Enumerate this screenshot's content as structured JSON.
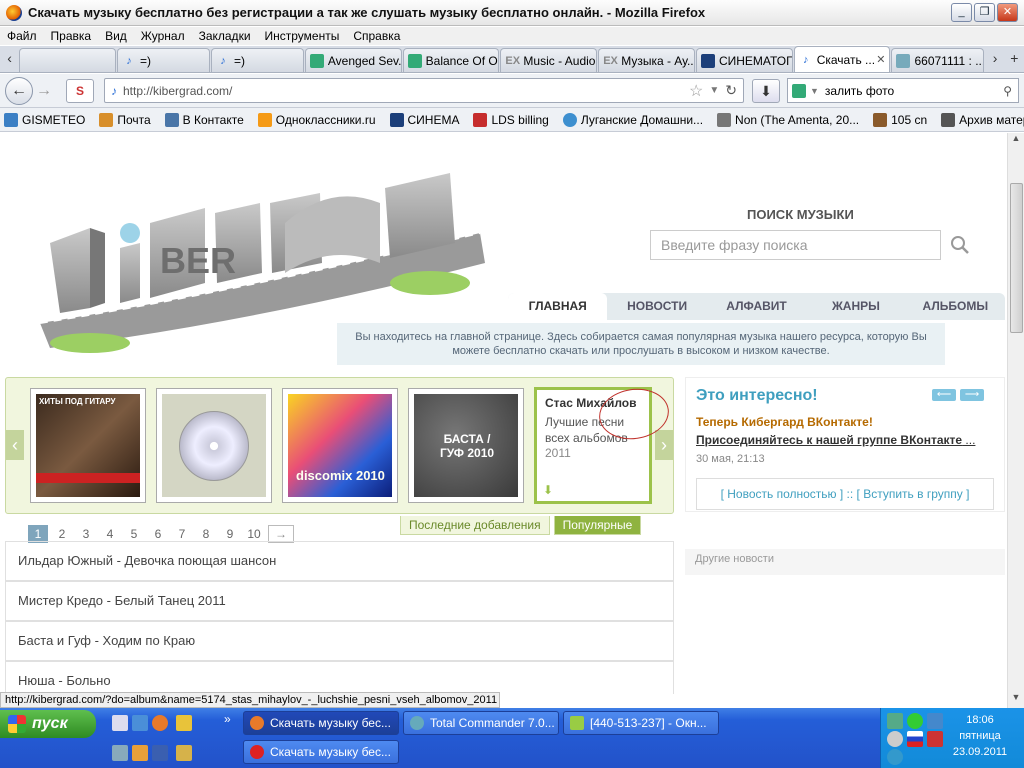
{
  "window": {
    "title": "Скачать музыку бесплатно без регистрации а так же слушать музыку бесплатно онлайн. - Mozilla Firefox"
  },
  "menu": [
    "Файл",
    "Правка",
    "Вид",
    "Журнал",
    "Закладки",
    "Инструменты",
    "Справка"
  ],
  "tabs": [
    {
      "label": "",
      "icon": "blank-page-icon"
    },
    {
      "label": "=)",
      "icon": "music-note-icon"
    },
    {
      "label": "=)",
      "icon": "music-note-icon"
    },
    {
      "label": "Avenged Sev...",
      "icon": "google-icon"
    },
    {
      "label": "Balance Of O...",
      "icon": "google-icon"
    },
    {
      "label": "Music - Audio...",
      "icon": "ex-icon"
    },
    {
      "label": "Музыка - Ау...",
      "icon": "ex-icon"
    },
    {
      "label": "СИНЕМАТОГ...",
      "icon": "cinema-icon"
    },
    {
      "label": "Скачать ...",
      "icon": "music-note-icon",
      "active": true
    },
    {
      "label": "66071111 : ...",
      "icon": "photo-icon"
    }
  ],
  "nav": {
    "url": "http://kibergrad.com/",
    "search_value": "залить фото"
  },
  "bookmarks": [
    {
      "label": "GISMETEO",
      "icon": "weather-icon",
      "color": "#3b7fc4"
    },
    {
      "label": "Почта",
      "icon": "mail-icon",
      "color": "#d88f2b"
    },
    {
      "label": "В Контакте",
      "icon": "vk-icon",
      "color": "#4a76a8"
    },
    {
      "label": "Одноклассники.ru",
      "icon": "ok-icon",
      "color": "#f59a16"
    },
    {
      "label": "СИНЕМА",
      "icon": "cinema-icon",
      "color": "#1c3f7a"
    },
    {
      "label": "LDS billing",
      "icon": "billing-icon",
      "color": "#c62d2d"
    },
    {
      "label": "Луганские Домашни...",
      "icon": "net-icon",
      "color": "#3d8fcf"
    },
    {
      "label": "Non (The Amenta, 20...",
      "icon": "lastfm-icon",
      "color": "#777777"
    },
    {
      "label": "105 cn",
      "icon": "guitar-icon",
      "color": "#8a5a2b"
    },
    {
      "label": "Архив материалов - ...",
      "icon": "guitar-icon",
      "color": "#555555"
    }
  ],
  "site": {
    "logo_alt": "KiberGrad",
    "search_title": "ПОИСК МУЗЫКИ",
    "search_placeholder": "Введите фразу поиска",
    "nav_tabs": [
      "ГЛАВНАЯ",
      "НОВОСТИ",
      "АЛФАВИТ",
      "ЖАНРЫ",
      "АЛЬБОМЫ"
    ],
    "info": "Вы находитесь на главной странице. Здесь собирается самая популярная музыка нашего ресурса, которую Вы можете бесплатно скачать или прослушать в высоком и низком качестве.",
    "featured": {
      "artist": "Стас Михайлов",
      "title": "Лучшие песни всех альбомов",
      "year": "2011"
    },
    "covers": [
      {
        "label": "ХИТЫ ПОД ГИТАРУ"
      },
      {
        "label": ""
      },
      {
        "label": "discomix 2010"
      },
      {
        "label": "БАСТА / ГУФ 2010"
      }
    ],
    "subtabs": [
      "Последние добавления",
      "Популярные"
    ],
    "pager": [
      "1",
      "2",
      "3",
      "4",
      "5",
      "6",
      "7",
      "8",
      "9",
      "10"
    ],
    "tracks": [
      "Ильдар Южный - Девочка поющая шансон",
      "Мистер Кредо - Белый Танец 2011",
      "Баста и Гуф - Ходим по Краю",
      "Нюша - Больно"
    ],
    "side": {
      "heading": "Это интересно!",
      "news_title": "Теперь Кибергард ВКонтакте!",
      "news_link": "Присоединяйтесь к нашей группе ВКонтакте",
      "news_link_suffix": " ...",
      "date": "30 мая, 21:13",
      "links": "[ Новость полностью ] :: [ Вступить в группу ]",
      "other_news": "Другие новости"
    }
  },
  "status": "http://kibergrad.com/?do=album&name=5174_stas_mihaylov_-_luchshie_pesni_vseh_albomov_2011",
  "taskbar": {
    "start": "пуск",
    "tasks": [
      {
        "label": "Скачать музыку бес...",
        "active": true
      },
      {
        "label": "Total Commander 7.0..."
      },
      {
        "label": "[440-513-237] - Окн..."
      },
      {
        "label": "Скачать музыку бес..."
      }
    ],
    "clock": {
      "time": "18:06",
      "day": "пятница",
      "date": "23.09.2011"
    }
  }
}
